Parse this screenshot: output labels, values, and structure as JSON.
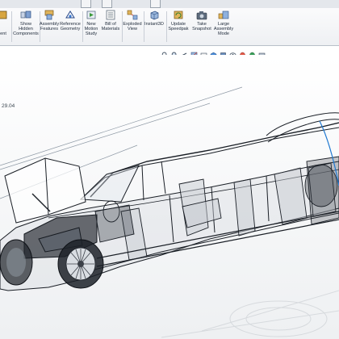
{
  "ribbon": {
    "items": [
      {
        "label": "ent",
        "icon": "insert-component-icon"
      },
      {
        "label": "Show\nHidden\nComponents",
        "icon": "show-hidden-components-icon"
      },
      {
        "label": "Assembly\nFeatures",
        "icon": "assembly-features-icon"
      },
      {
        "label": "Reference\nGeometry",
        "icon": "reference-geometry-icon"
      },
      {
        "label": "New\nMotion\nStudy",
        "icon": "motion-study-icon"
      },
      {
        "label": "Bill of\nMaterials",
        "icon": "bill-of-materials-icon"
      },
      {
        "label": "Exploded\nView",
        "icon": "exploded-view-icon"
      },
      {
        "label": "Instant3D",
        "icon": "instant3d-icon"
      },
      {
        "label": "Update\nSpeedpak",
        "icon": "update-speedpak-icon"
      },
      {
        "label": "Take\nSnapshot",
        "icon": "take-snapshot-icon"
      },
      {
        "label": "Large\nAssembly\nMode",
        "icon": "large-assembly-mode-icon"
      }
    ]
  },
  "hud": {
    "icons": [
      "zoom-to-fit-icon",
      "zoom-area-icon",
      "previous-view-icon",
      "section-view-icon",
      "dynamic-annotation-icon",
      "view-orientation-icon",
      "display-style-icon",
      "hide-show-items-icon",
      "edit-appearance-icon",
      "apply-scene-icon",
      "view-settings-icon"
    ]
  },
  "model": {
    "dimension_label": "29.04",
    "description": "transparent limousine assembly"
  },
  "colors": {
    "ribbon_bg": "#f0f2f5",
    "label_text": "#1e2a3a",
    "model_stroke": "#1a1f26",
    "model_shade": "#c7ccd2"
  }
}
